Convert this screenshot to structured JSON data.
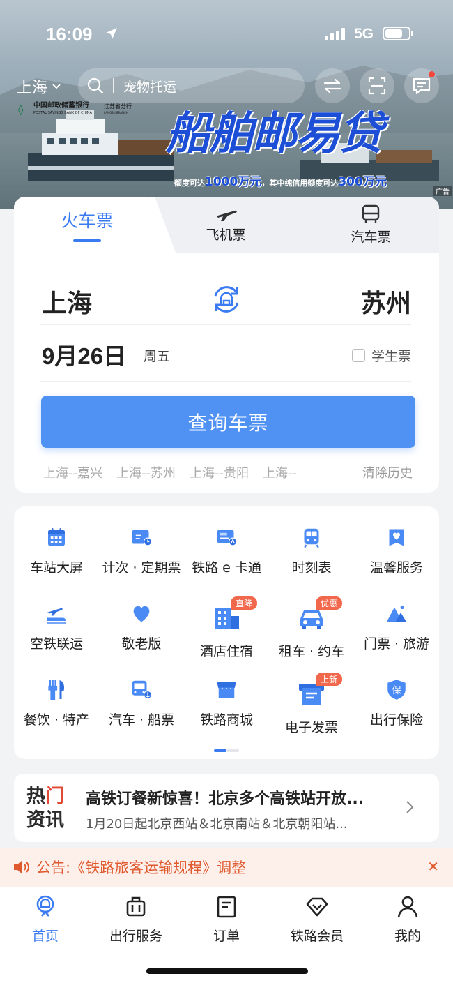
{
  "status_bar": {
    "time": "16:09",
    "network": "5G"
  },
  "header": {
    "city": "上海",
    "search_placeholder": "宠物托运"
  },
  "ad": {
    "bank_name": "中国邮政储蓄银行",
    "bank_name_en": "POSTAL SAVINGS BANK OF CHINA",
    "branch": "江苏省分行",
    "branch_en": "JIANGSU BRANCH",
    "title": "船舶邮易贷",
    "sub_prefix": "额度可达",
    "sub_amount1": "1000万元",
    "sub_middle": "，其中纯信用额度可达",
    "sub_amount2": "300万元",
    "tag": "广告"
  },
  "ticket": {
    "tabs": [
      {
        "label": "火车票",
        "icon": "train-icon"
      },
      {
        "label": "飞机票",
        "icon": "plane-icon"
      },
      {
        "label": "汽车票",
        "icon": "bus-icon"
      }
    ],
    "from": "上海",
    "to": "苏州",
    "date": "9月26日",
    "weekday": "周五",
    "student_label": "学生票",
    "query_button": "查询车票",
    "history": [
      "上海--嘉兴",
      "上海--苏州",
      "上海--贵阳",
      "上海--"
    ],
    "clear_history": "清除历史"
  },
  "services": [
    {
      "label": "车站大屏",
      "icon": "calendar-icon"
    },
    {
      "label": "计次 · 定期票",
      "icon": "ticket-clock-icon"
    },
    {
      "label": "铁路 e 卡通",
      "icon": "card-icon"
    },
    {
      "label": "时刻表",
      "icon": "train-front-icon"
    },
    {
      "label": "温馨服务",
      "icon": "heart-flag-icon"
    },
    {
      "label": "空铁联运",
      "icon": "plane-train-icon"
    },
    {
      "label": "敬老版",
      "icon": "heart-icon"
    },
    {
      "label": "酒店住宿",
      "icon": "hotel-icon",
      "badge": "直降"
    },
    {
      "label": "租车 · 约车",
      "icon": "car-icon",
      "badge": "优惠"
    },
    {
      "label": "门票 · 旅游",
      "icon": "mountain-icon"
    },
    {
      "label": "餐饮 · 特产",
      "icon": "fork-knife-icon"
    },
    {
      "label": "汽车 · 船票",
      "icon": "bus-anchor-icon"
    },
    {
      "label": "铁路商城",
      "icon": "shop-icon"
    },
    {
      "label": "电子发票",
      "icon": "invoice-icon",
      "badge": "上新"
    },
    {
      "label": "出行保险",
      "icon": "shield-icon",
      "shield_text": "保"
    }
  ],
  "news": {
    "label_top": "热门",
    "label_bottom": "资讯",
    "title": "高铁订餐新惊喜！北京多个高铁站开放...",
    "subtitle": "1月20日起北京西站＆北京南站＆北京朝阳站..."
  },
  "notice": {
    "text": "公告:《铁路旅客运输规程》调整"
  },
  "nav": [
    {
      "label": "首页",
      "icon": "home-icon",
      "active": true
    },
    {
      "label": "出行服务",
      "icon": "luggage-icon"
    },
    {
      "label": "订单",
      "icon": "order-icon"
    },
    {
      "label": "铁路会员",
      "icon": "diamond-icon"
    },
    {
      "label": "我的",
      "icon": "person-icon"
    }
  ],
  "colors": {
    "accent": "#3b7bf2",
    "button": "#5092f4",
    "notice": "#e0592e",
    "badge": "#f2684c"
  }
}
